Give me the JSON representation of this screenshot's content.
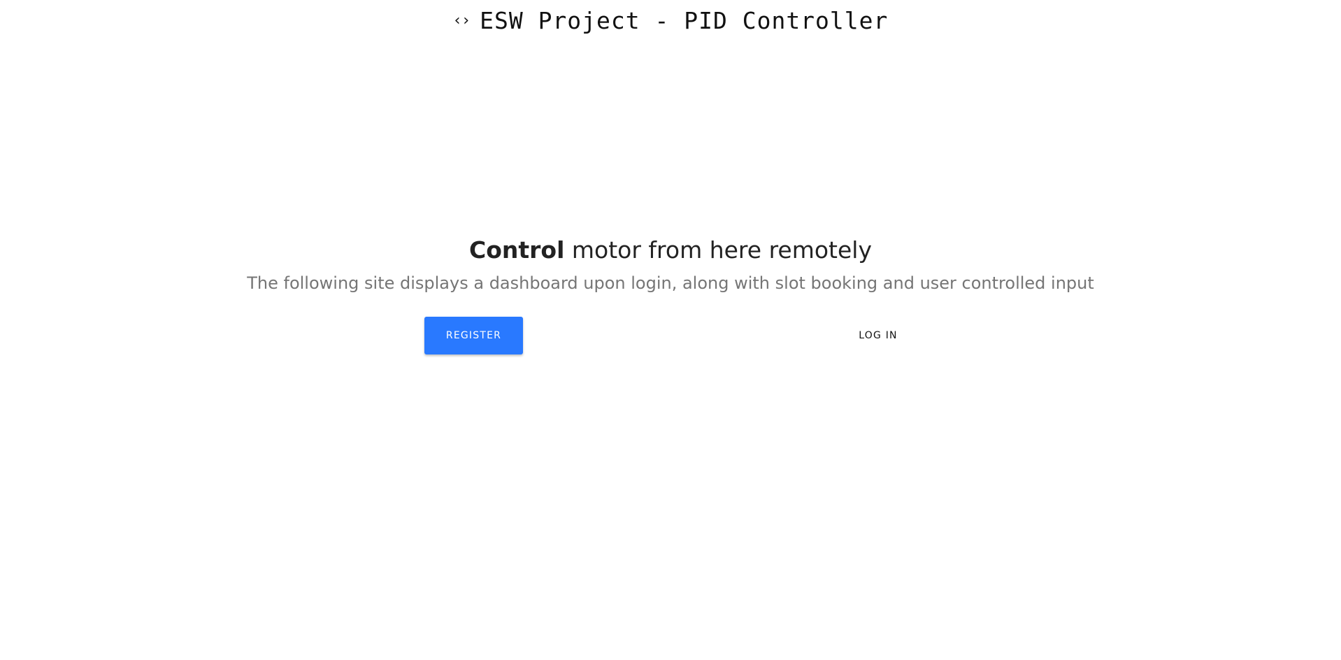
{
  "header": {
    "icon": "code-icon",
    "icon_glyph": "‹›",
    "title": "ESW Project - PID Controller"
  },
  "hero": {
    "heading_strong": "Control",
    "heading_rest": " motor from here remotely",
    "subtitle": "The following site displays a dashboard upon login, along with slot booking and user controlled input"
  },
  "actions": {
    "register_label": "REGISTER",
    "login_label": "LOG IN"
  },
  "colors": {
    "accent": "#2979ff",
    "heading": "#222222",
    "subtitle": "#757575"
  }
}
